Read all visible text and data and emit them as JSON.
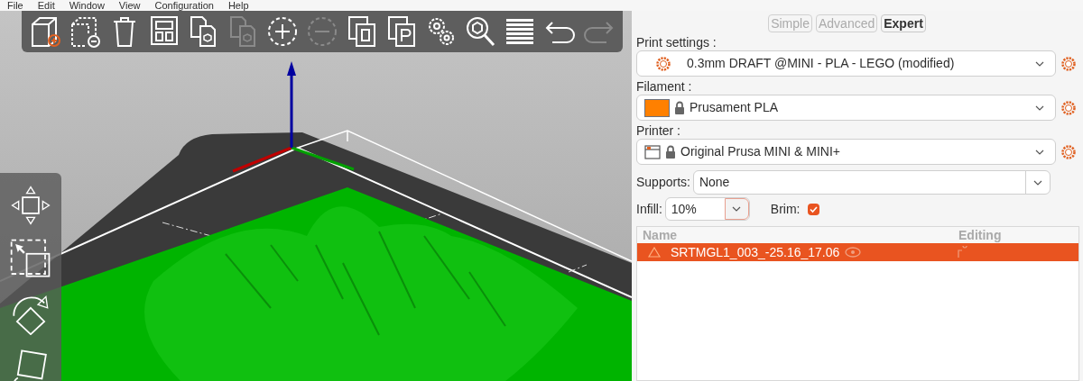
{
  "menu": [
    "File",
    "Edit",
    "Window",
    "View",
    "Configuration",
    "Help"
  ],
  "toolbar": [
    {
      "kind": "add",
      "disabled": false
    },
    {
      "kind": "delete",
      "disabled": false
    },
    {
      "kind": "delete_all",
      "disabled": false
    },
    {
      "kind": "arrange",
      "disabled": false
    },
    {
      "kind": "copy",
      "disabled": false
    },
    {
      "kind": "paste",
      "disabled": true
    },
    {
      "kind": "plus",
      "disabled": false
    },
    {
      "kind": "minus",
      "disabled": true
    },
    {
      "kind": "split_objects",
      "disabled": false
    },
    {
      "kind": "split_parts",
      "disabled": false
    },
    {
      "kind": "settings",
      "disabled": false
    },
    {
      "kind": "search",
      "disabled": false
    },
    {
      "kind": "layers",
      "disabled": false
    },
    {
      "kind": "undo",
      "disabled": false
    },
    {
      "kind": "redo",
      "disabled": true
    }
  ],
  "gizmos": [
    {
      "kind": "move"
    },
    {
      "kind": "select"
    },
    {
      "kind": "rotate"
    },
    {
      "kind": "scale"
    }
  ],
  "modes": [
    {
      "label": "Simple",
      "selected": false
    },
    {
      "label": "Advanced",
      "selected": false
    },
    {
      "label": "Expert",
      "selected": true
    }
  ],
  "presets": [
    {
      "label": "Print settings :",
      "kind": "print",
      "value": "0.3mm DRAFT @MINI - PLA - LEGO (modified)",
      "locked": false
    },
    {
      "label": "Filament :",
      "kind": "filament",
      "value": "Prusament PLA",
      "locked": true,
      "color": "#ff8000"
    },
    {
      "label": "Printer :",
      "kind": "printer",
      "value": "Original Prusa MINI & MINI+",
      "locked": true
    }
  ],
  "supports": {
    "label": "Supports:",
    "value": "None"
  },
  "infill": {
    "label": "Infill:",
    "value": "10%"
  },
  "brim": {
    "label": "Brim:",
    "checked": true
  },
  "object_list": {
    "columns": [
      "Name",
      "Editing"
    ],
    "rows": [
      {
        "name": "SRTMGL1_003_-25.16_17.06",
        "selected": true,
        "warning": true
      }
    ]
  }
}
